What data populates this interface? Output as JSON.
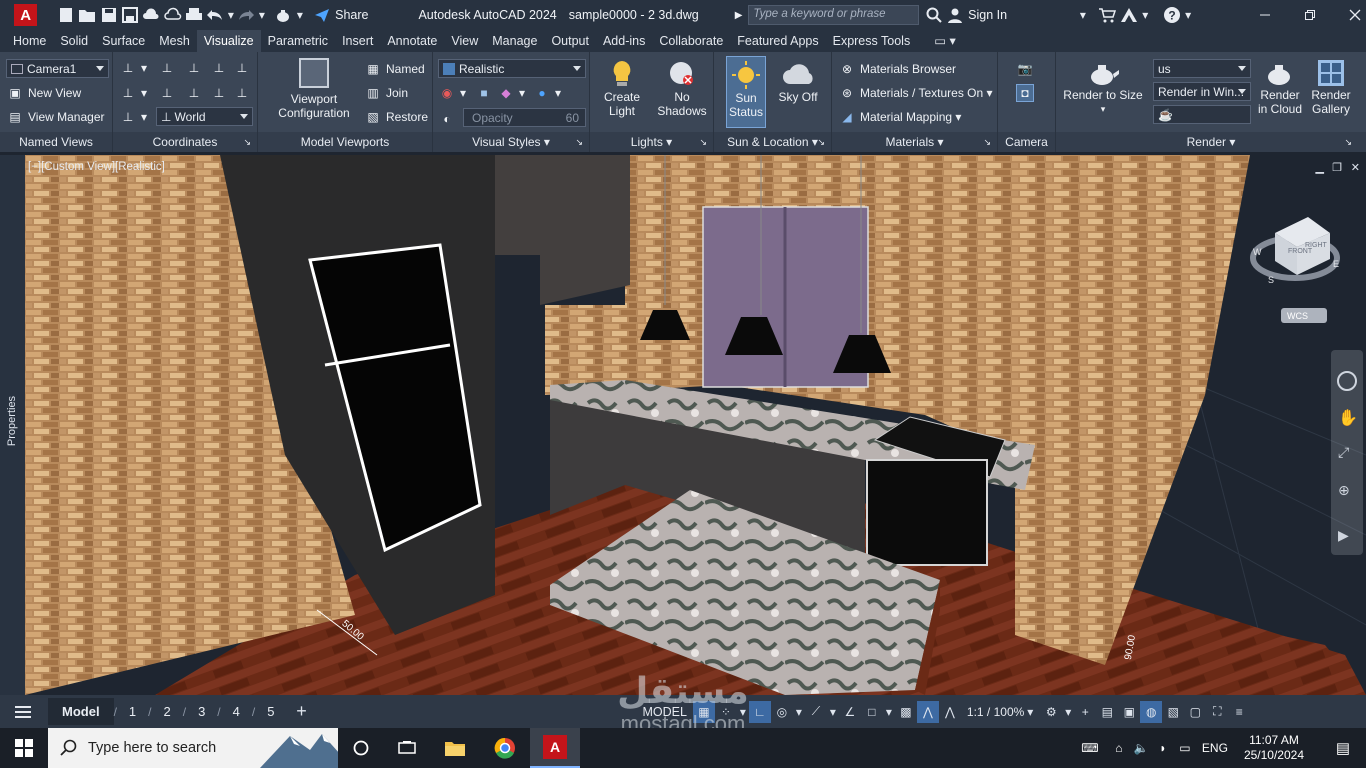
{
  "titlebar": {
    "app_name": "Autodesk AutoCAD 2024",
    "file_name": "sample0000 - 2 3d.dwg",
    "share_label": "Share",
    "search_placeholder": "Type a keyword or phrase",
    "sign_in_label": "Sign In",
    "logo_letter": "A"
  },
  "tabs": [
    "Home",
    "Solid",
    "Surface",
    "Mesh",
    "Visualize",
    "Parametric",
    "Insert",
    "Annotate",
    "View",
    "Manage",
    "Output",
    "Add-ins",
    "Collaborate",
    "Featured Apps",
    "Express Tools"
  ],
  "active_tab": "Visualize",
  "ribbon": {
    "named_views": {
      "title": "Named Views",
      "camera": "Camera1",
      "new_view": "New View",
      "view_manager": "View Manager"
    },
    "coordinates": {
      "title": "Coordinates",
      "ucs": "World"
    },
    "model_viewports": {
      "title": "Model Viewports",
      "viewport_config": "Viewport Configuration",
      "named": "Named",
      "join": "Join",
      "restore": "Restore"
    },
    "visual_styles": {
      "title": "Visual Styles",
      "style": "Realistic",
      "opacity_label": "Opacity",
      "opacity_value": "60"
    },
    "lights": {
      "title": "Lights",
      "create_light": "Create Light",
      "no_shadows": "No Shadows"
    },
    "sun_location": {
      "title": "Sun & Location",
      "sun_status": "Sun Status",
      "sky_off": "Sky Off"
    },
    "materials": {
      "title": "Materials",
      "browser": "Materials Browser",
      "textures": "Materials / Textures On",
      "mapping": "Material Mapping"
    },
    "camera": {
      "title": "Camera"
    },
    "render": {
      "title": "Render",
      "render_to_size": "Render to Size",
      "preset": "us",
      "render_in": "Render in Win...",
      "render_cloud": "Render in Cloud",
      "render_gallery": "Render Gallery"
    }
  },
  "viewport": {
    "label": "[−][Custom View][Realistic]",
    "properties_label": "Properties",
    "viewcube": {
      "front": "FRONT",
      "right": "RIGHT",
      "wcs": "WCS",
      "s": "S",
      "e": "E",
      "w": "W"
    },
    "dims": [
      "50.00",
      "90.00"
    ]
  },
  "layout_tabs": [
    "Model",
    "1",
    "2",
    "3",
    "4",
    "5"
  ],
  "status": {
    "model": "MODEL",
    "scale": "1:1 / 100%"
  },
  "watermark": {
    "arabic": "مستقل",
    "latin": "mostaql.com"
  },
  "taskbar": {
    "search_placeholder": "Type here to search",
    "lang": "ENG",
    "time": "11:07 AM",
    "date": "25/10/2024"
  }
}
